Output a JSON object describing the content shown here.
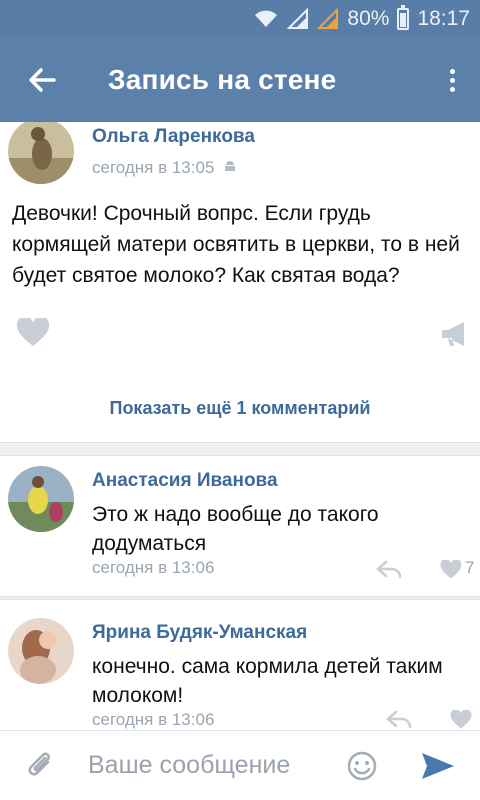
{
  "status_bar": {
    "battery": "80%",
    "time": "18:17"
  },
  "app_bar": {
    "title": "Запись на стене"
  },
  "post": {
    "author": "Ольга Ларенкова",
    "time": "сегодня в 13:05",
    "text": "Девочки! Срочный вопрс. Если грудь кормящей матери освятить в церкви, то в ней будет святое молоко? Как святая вода?"
  },
  "show_more": "Показать ещё 1 комментарий",
  "comments": [
    {
      "author": "Анастасия Иванова",
      "text": "Это ж надо вообще до такого додуматься",
      "time": "сегодня в 13:06",
      "likes": "7"
    },
    {
      "author": "Ярина Будяк-Уманская",
      "text": "конечно. сама кормила детей таким молоком!",
      "time": "сегодня в 13:06",
      "likes": ""
    }
  ],
  "composer": {
    "placeholder": "Ваше сообщение"
  },
  "colors": {
    "accent": "#5b80aa",
    "link": "#3e6a99",
    "muted": "#9aa5b1"
  },
  "icons": [
    "wifi-icon",
    "signal-icon",
    "battery-icon",
    "back-arrow-icon",
    "more-vert-icon",
    "android-icon",
    "heart-icon",
    "megaphone-icon",
    "reply-icon",
    "attach-icon",
    "emoji-icon",
    "send-icon"
  ]
}
